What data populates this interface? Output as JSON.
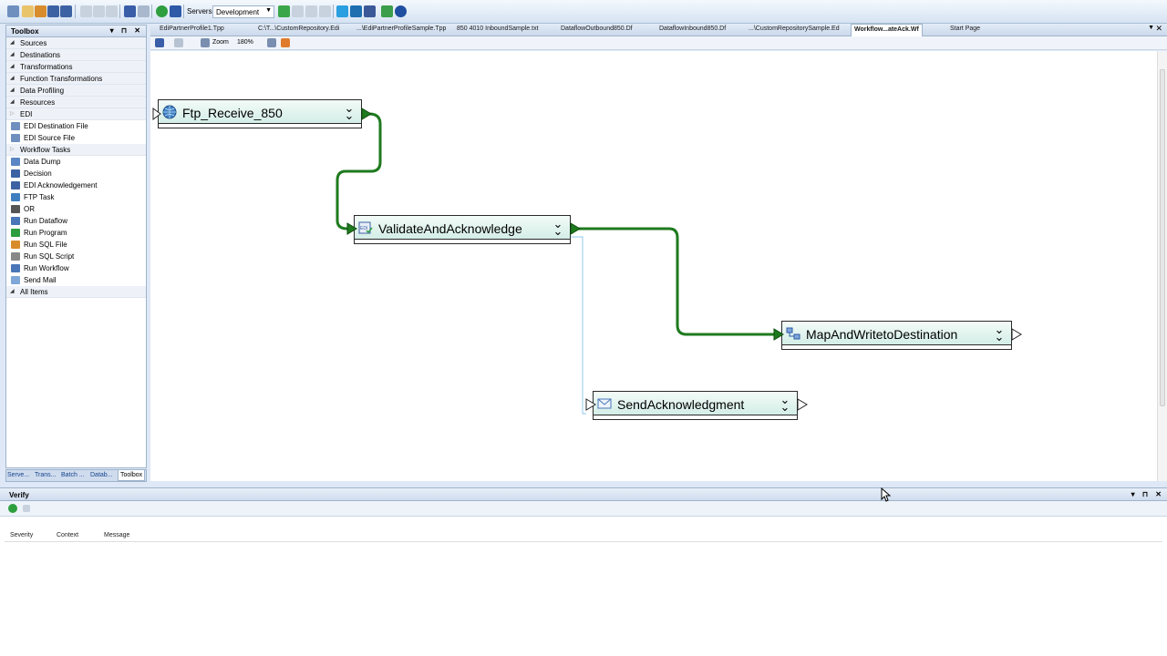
{
  "toolbar": {
    "servers_label": "Servers",
    "servers_value": "Development"
  },
  "toolbox": {
    "title": "Toolbox",
    "items": [
      {
        "label": "Sources",
        "kind": "category"
      },
      {
        "label": "Destinations",
        "kind": "category"
      },
      {
        "label": "Transformations",
        "kind": "category"
      },
      {
        "label": "Function Transformations",
        "kind": "category"
      },
      {
        "label": "Data Profiling",
        "kind": "category"
      },
      {
        "label": "Resources",
        "kind": "category"
      },
      {
        "label": "EDI",
        "kind": "category-collapsed"
      },
      {
        "label": "EDI Destination File",
        "kind": "leaf",
        "icon": "edi-file-icon"
      },
      {
        "label": "EDI Source File",
        "kind": "leaf",
        "icon": "edi-file-icon"
      },
      {
        "label": "Workflow Tasks",
        "kind": "category-collapsed"
      },
      {
        "label": "Data Dump",
        "kind": "leaf",
        "icon": "data-dump-icon"
      },
      {
        "label": "Decision",
        "kind": "leaf",
        "icon": "decision-icon"
      },
      {
        "label": "EDI Acknowledgement",
        "kind": "leaf",
        "icon": "edi-ack-icon"
      },
      {
        "label": "FTP Task",
        "kind": "leaf",
        "icon": "ftp-globe-icon"
      },
      {
        "label": "OR",
        "kind": "leaf",
        "icon": "or-icon"
      },
      {
        "label": "Run Dataflow",
        "kind": "leaf",
        "icon": "dataflow-icon"
      },
      {
        "label": "Run Program",
        "kind": "leaf",
        "icon": "program-icon"
      },
      {
        "label": "Run SQL File",
        "kind": "leaf",
        "icon": "sql-file-icon"
      },
      {
        "label": "Run SQL Script",
        "kind": "leaf",
        "icon": "sql-script-icon"
      },
      {
        "label": "Run Workflow",
        "kind": "leaf",
        "icon": "workflow-icon"
      },
      {
        "label": "Send Mail",
        "kind": "leaf",
        "icon": "mail-icon"
      },
      {
        "label": "All Items",
        "kind": "category"
      }
    ],
    "bottom_tabs": [
      "Serve...",
      "Trans...",
      "Batch ...",
      "Datab...",
      "Toolbox"
    ]
  },
  "doc_tabs": [
    "EdiPartnerProfile1.Tpp",
    "C:\\T...\\CustomRepository.Edi",
    "...\\EdiPartnerProfileSample.Tpp",
    "850 4010 InboundSample.txt",
    "DataflowOutbound850.Df",
    "DataflowInbound850.Df",
    "...\\CustomRepositorySample.Ed",
    "Workflow...ateAck.Wf",
    "Start Page"
  ],
  "canvas_toolbar": {
    "zoom_label": "Zoom",
    "zoom_value": "180%"
  },
  "workflow": {
    "nodes": [
      {
        "id": "ftp",
        "label": "Ftp_Receive_850",
        "icon": "ftp-globe-icon"
      },
      {
        "id": "validate",
        "label": "ValidateAndAcknowledge",
        "icon": "edi-ack-icon"
      },
      {
        "id": "map",
        "label": "MapAndWritetoDestination",
        "icon": "dataflow-icon"
      },
      {
        "id": "send",
        "label": "SendAcknowledgment",
        "icon": "mail-icon"
      }
    ],
    "connection_color": "#1e7a1e",
    "secondary_connection_color": "#8fc8ef"
  },
  "verify": {
    "title": "Verify",
    "columns": [
      "Severity",
      "Context",
      "Message"
    ]
  }
}
